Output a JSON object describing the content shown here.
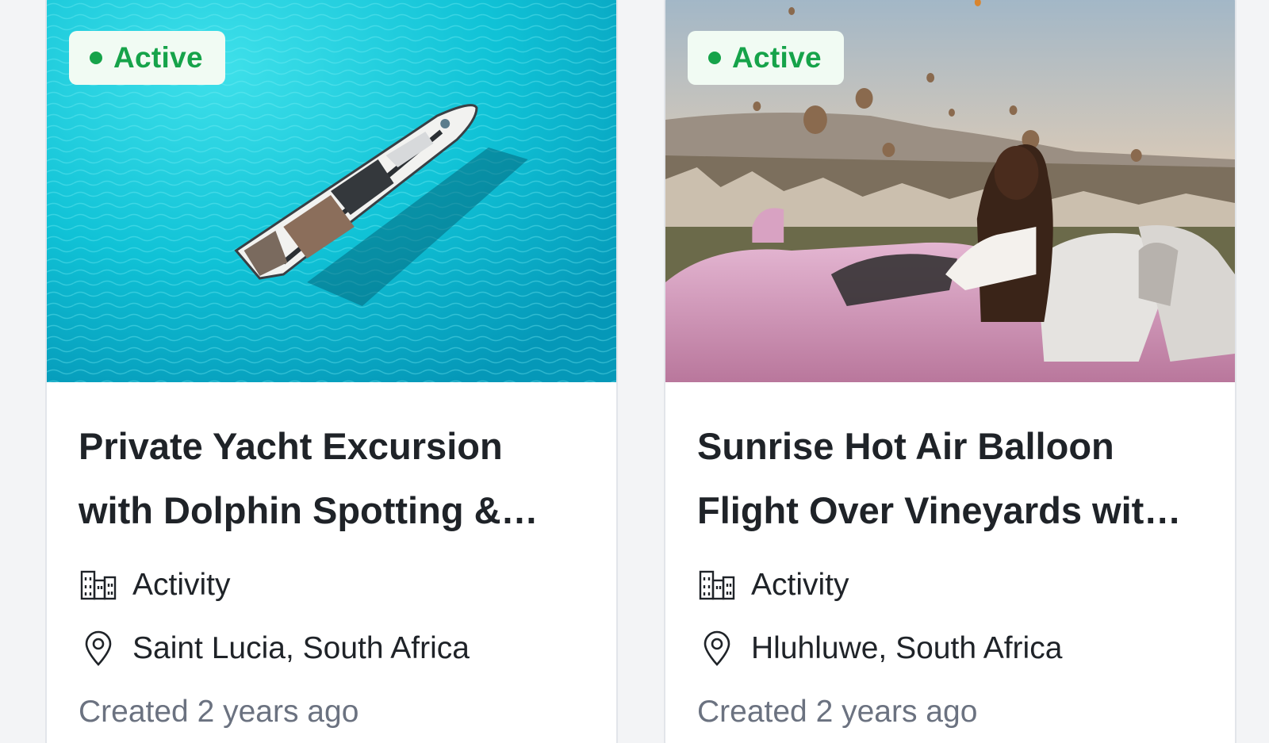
{
  "cards": [
    {
      "status": "Active",
      "title": "Private Yacht Excursion with Dolphin Spotting & Sunset Drinks",
      "category": "Activity",
      "location": "Saint Lucia, South Africa",
      "created": "Created 2 years ago",
      "image_alt": "Aerial view of a yacht on turquoise water"
    },
    {
      "status": "Active",
      "title": "Sunrise Hot Air Balloon Flight Over Vineyards with Champagne Breakfast",
      "category": "Activity",
      "location": "Hluhluwe, South Africa",
      "created": "Created 2 years ago",
      "image_alt": "Woman in a pink convertible watching hot air balloons at sunrise"
    }
  ],
  "colors": {
    "status_green": "#16a34a",
    "badge_bg": "#f1fbf3",
    "title_text": "#1f2328",
    "muted_text": "#6b7280",
    "card_border": "#e2e5ea"
  },
  "icons": {
    "category": "building-icon",
    "location": "map-pin-icon"
  }
}
